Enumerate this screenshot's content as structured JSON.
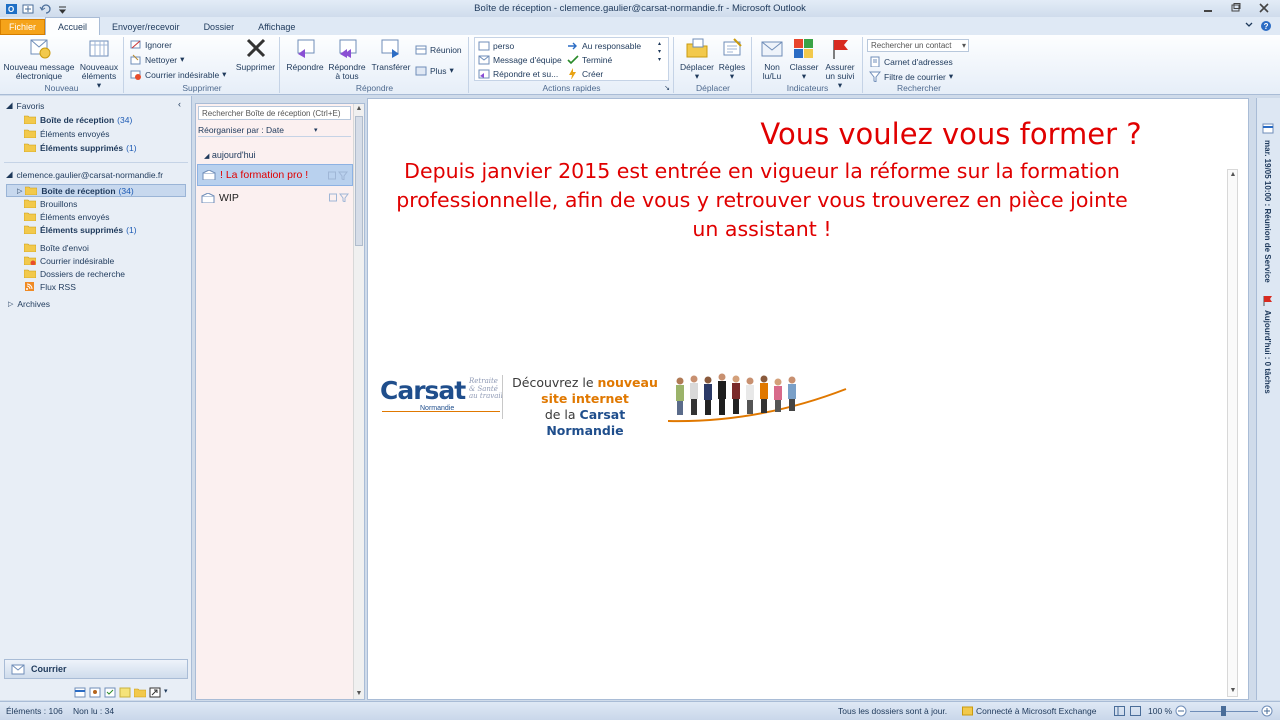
{
  "window": {
    "title": "Boîte de réception - clemence.gaulier@carsat-normandie.fr - Microsoft Outlook"
  },
  "ribbon_tabs": [
    "Fichier",
    "Accueil",
    "Envoyer/recevoir",
    "Dossier",
    "Affichage"
  ],
  "ribbon": {
    "nouveau": {
      "label": "Nouveau",
      "new_message": "Nouveau message électronique",
      "new_items": "Nouveaux éléments"
    },
    "supprimer": {
      "label": "Supprimer",
      "ignore": "Ignorer",
      "clean": "Nettoyer",
      "junk": "Courrier indésirable",
      "delete": "Supprimer"
    },
    "repondre": {
      "label": "Répondre",
      "reply": "Répondre",
      "reply_all": "Répondre à tous",
      "forward": "Transférer",
      "meeting": "Réunion",
      "more": "Plus"
    },
    "actions_rapides": {
      "label": "Actions rapides",
      "items": [
        "perso",
        "Au responsable",
        "Message d'équipe",
        "Terminé",
        "Répondre et su...",
        "Créer"
      ]
    },
    "deplacer": {
      "label": "Déplacer",
      "move": "Déplacer",
      "rules": "Règles"
    },
    "indicateurs": {
      "label": "Indicateurs",
      "unread": "Non lu/Lu",
      "categorize": "Classer",
      "followup": "Assurer un suivi"
    },
    "rechercher": {
      "label": "Rechercher",
      "search_contact_placeholder": "Rechercher un contact",
      "address_book": "Carnet d'adresses",
      "filter": "Filtre de courrier"
    }
  },
  "navigation": {
    "favorites_title": "Favoris",
    "favorites": [
      {
        "name": "Boîte de réception",
        "count": "(34)",
        "bold": true
      },
      {
        "name": "Éléments envoyés",
        "count": "",
        "bold": false
      },
      {
        "name": "Éléments supprimés",
        "count": "(1)",
        "bold": true
      }
    ],
    "account": "clemence.gaulier@carsat-normandie.fr",
    "folders": [
      {
        "name": "Boîte de réception",
        "count": "(34)",
        "bold": true
      },
      {
        "name": "Brouillons",
        "count": "",
        "bold": false
      },
      {
        "name": "Éléments envoyés",
        "count": "",
        "bold": false
      },
      {
        "name": "Éléments supprimés",
        "count": "(1)",
        "bold": true
      },
      {
        "name": "Boîte d'envoi",
        "count": "",
        "bold": false
      },
      {
        "name": "Courrier indésirable",
        "count": "",
        "bold": false
      },
      {
        "name": "Dossiers de recherche",
        "count": "",
        "bold": false
      },
      {
        "name": "Flux RSS",
        "count": "",
        "bold": false
      }
    ],
    "archives": "Archives",
    "mail_button": "Courrier"
  },
  "message_list": {
    "search_placeholder": "Rechercher Boîte de réception (Ctrl+E)",
    "arrange_by": "Réorganiser par : Date",
    "group_header": "aujourd'hui",
    "messages": [
      {
        "subject": "! La formation pro !",
        "selected": true
      },
      {
        "subject": "WIP",
        "selected": false
      }
    ]
  },
  "reading_pane": {
    "heading": "Vous voulez vous former ?",
    "body": "Depuis janvier 2015 est entrée en vigueur la réforme sur la formation professionnelle, afin de vous y retrouver vous trouverez en pièce jointe un assistant !",
    "banner": {
      "brand": "Carsat",
      "brand_sub": [
        "Retraite",
        "& Santé",
        "au travail"
      ],
      "brand_region": "Normandie",
      "line1_a": "Découvrez le ",
      "line1_b": "nouveau",
      "line2": "site internet",
      "line3_a": "de la ",
      "line3_b": "Carsat Normandie"
    }
  },
  "todo_bar": {
    "appointment": "mar. 19/05 10:00 : Réunion de Service",
    "tasks": "Aujourd'hui : 0 tâches"
  },
  "status_bar": {
    "items": "Éléments : 106",
    "unread": "Non lu : 34",
    "sync": "Tous les dossiers sont à jour.",
    "connection": "Connecté à Microsoft Exchange",
    "zoom": "100 %"
  },
  "colors": {
    "accent_file_tab": "#f5a31a",
    "email_text": "#e00000",
    "carsat_blue": "#1f4e8c",
    "carsat_orange": "#e07800"
  }
}
